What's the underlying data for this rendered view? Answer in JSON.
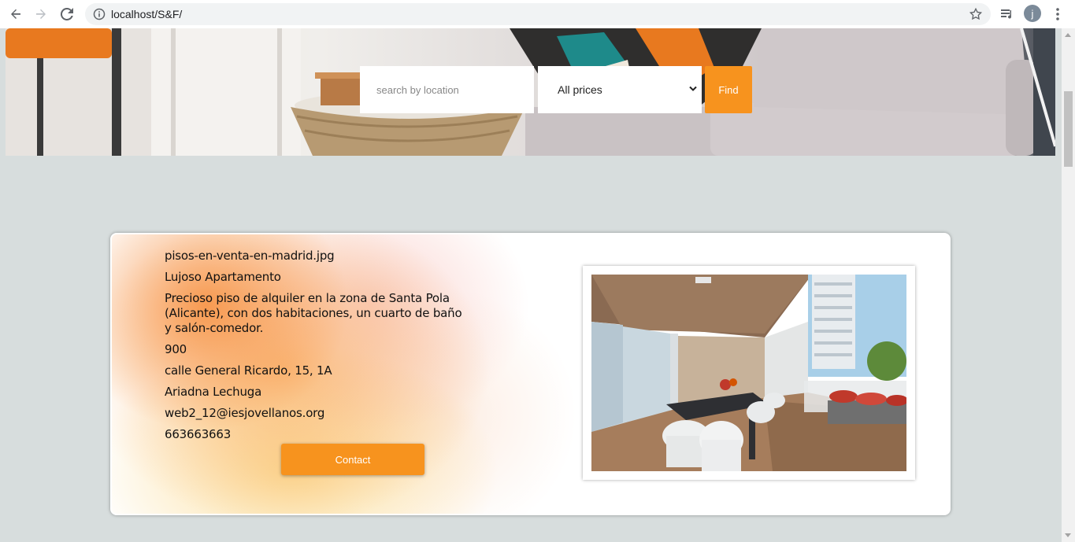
{
  "browser": {
    "url": "localhost/S&F/",
    "profile_initial": "j",
    "icons": [
      "back-icon",
      "forward-icon",
      "reload-icon",
      "info-icon",
      "star-icon",
      "media-icon",
      "menu-icon"
    ]
  },
  "search": {
    "placeholder": "search by location",
    "price_selected": "All prices",
    "find_label": "Find"
  },
  "listing": {
    "image_name": "pisos-en-venta-en-madrid.jpg",
    "title": "Lujoso Apartamento",
    "description": "Precioso piso de alquiler en la zona de Santa Pola (Alicante), con dos habitaciones, un cuarto de baño y salón-comedor.",
    "price": "900",
    "address": "calle General Ricardo, 15, 1A",
    "owner": "Ariadna Lechuga",
    "email": "web2_12@iesjovellanos.org",
    "phone": "663663663",
    "contact_label": "Contact"
  },
  "colors": {
    "accent": "#f7931e",
    "page_bg": "#d7dddd"
  }
}
